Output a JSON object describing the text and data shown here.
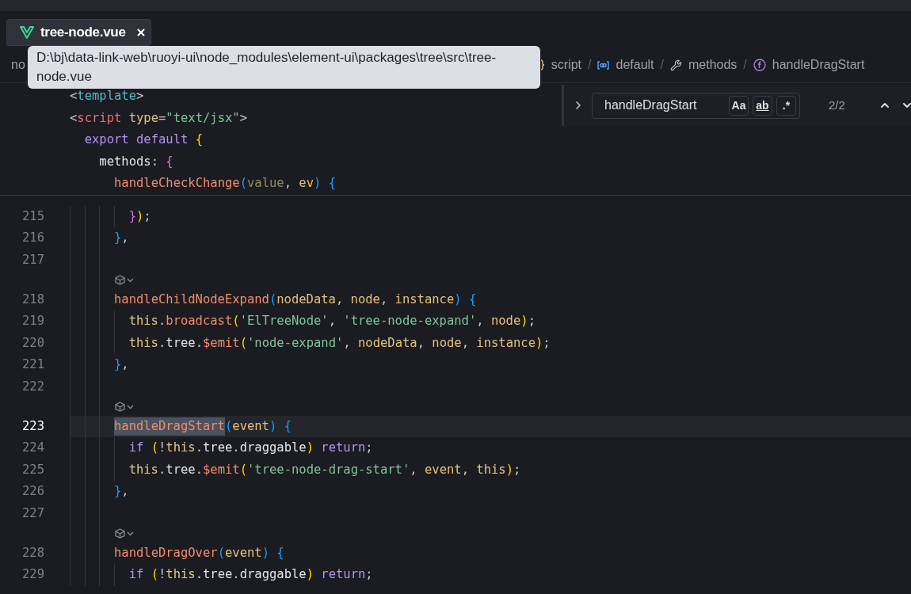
{
  "tab": {
    "label": "tree-node.vue",
    "selected": true
  },
  "tooltip": {
    "text": "D:\\bj\\data-link-web\\ruoyi-ui\\node_modules\\element-ui\\packages\\tree\\src\\tree-node.vue"
  },
  "breadcrumb": [
    {
      "kind": "text",
      "text": "no"
    },
    {
      "kind": "script",
      "text": "script",
      "separator": "/"
    },
    {
      "kind": "module",
      "text": "default",
      "separator": "/"
    },
    {
      "kind": "property",
      "text": "methods",
      "separator": "/"
    },
    {
      "kind": "function",
      "text": "handleDragStart"
    }
  ],
  "find_widget": {
    "value": "handleDragStart",
    "options": [
      {
        "kind": "case",
        "label": "Aa",
        "selected": false
      },
      {
        "kind": "word",
        "label": "ab",
        "selected": false
      },
      {
        "kind": "regex",
        "label": ".*",
        "selected": false
      }
    ],
    "count": "2/2"
  },
  "sticky_lines": [
    {
      "tokens": [
        {
          "text": "<",
          "kind": "punct"
        },
        {
          "text": "template",
          "kind": "template_tag"
        },
        {
          "text": ">",
          "kind": "punct"
        }
      ]
    },
    {
      "tokens": [
        {
          "text": "<",
          "kind": "punct"
        },
        {
          "text": "script",
          "kind": "tag"
        },
        {
          "text": " type",
          "kind": "attr"
        },
        {
          "text": "=",
          "kind": "punct"
        },
        {
          "text": "\"text/jsx\"",
          "kind": "string"
        },
        {
          "text": ">",
          "kind": "punct"
        }
      ]
    },
    {
      "tokens": [
        {
          "text": "  export default",
          "kind": "keyword"
        },
        {
          "text": " {",
          "kind": "bracket1"
        }
      ]
    },
    {
      "tokens": [
        {
          "text": "    methods",
          "kind": "prop"
        },
        {
          "text": ": ",
          "kind": "punct"
        },
        {
          "text": "{",
          "kind": "bracket2"
        }
      ]
    },
    {
      "tokens": [
        {
          "text": "      handleCheckChange",
          "kind": "func"
        },
        {
          "text": "(",
          "kind": "bracket3"
        },
        {
          "text": "value",
          "kind": "unused"
        },
        {
          "text": ", ",
          "kind": "punct"
        },
        {
          "text": "ev",
          "kind": "param"
        },
        {
          "text": ")",
          "kind": "bracket3"
        },
        {
          "text": " {",
          "kind": "bracket3"
        }
      ]
    }
  ],
  "lines": [
    {
      "kind": "code",
      "number": "215",
      "current": false,
      "tokens": [
        {
          "text": "        }",
          "kind": "bracket2"
        },
        {
          "text": ")",
          "kind": "bracket1"
        },
        {
          "text": ";",
          "kind": "punct"
        }
      ]
    },
    {
      "kind": "code",
      "number": "216",
      "current": false,
      "tokens": [
        {
          "text": "      }",
          "kind": "bracket3"
        },
        {
          "text": ",",
          "kind": "punct"
        }
      ]
    },
    {
      "kind": "code",
      "number": "217",
      "current": false
    },
    {
      "kind": "codelens"
    },
    {
      "kind": "code",
      "number": "218",
      "current": false,
      "tokens": [
        {
          "text": "      handleChildNodeExpand",
          "kind": "func"
        },
        {
          "text": "(",
          "kind": "bracket3"
        },
        {
          "text": "nodeData",
          "kind": "param"
        },
        {
          "text": ", ",
          "kind": "punct"
        },
        {
          "text": "node",
          "kind": "param"
        },
        {
          "text": ", ",
          "kind": "punct"
        },
        {
          "text": "instance",
          "kind": "param"
        },
        {
          "text": ")",
          "kind": "bracket3"
        },
        {
          "text": " {",
          "kind": "bracket3"
        }
      ]
    },
    {
      "kind": "code",
      "number": "219",
      "current": false,
      "tokens": [
        {
          "text": "        this",
          "kind": "this"
        },
        {
          "text": ".",
          "kind": "punct"
        },
        {
          "text": "broadcast",
          "kind": "func"
        },
        {
          "text": "(",
          "kind": "bracket1"
        },
        {
          "text": "'ElTreeNode'",
          "kind": "string"
        },
        {
          "text": ", ",
          "kind": "punct"
        },
        {
          "text": "'tree-node-expand'",
          "kind": "string"
        },
        {
          "text": ", ",
          "kind": "punct"
        },
        {
          "text": "node",
          "kind": "param"
        },
        {
          "text": ")",
          "kind": "bracket1"
        },
        {
          "text": ";",
          "kind": "punct"
        }
      ]
    },
    {
      "kind": "code",
      "number": "220",
      "current": false,
      "tokens": [
        {
          "text": "        this",
          "kind": "this"
        },
        {
          "text": ".",
          "kind": "punct"
        },
        {
          "text": "tree",
          "kind": "prop"
        },
        {
          "text": ".",
          "kind": "punct"
        },
        {
          "text": "$emit",
          "kind": "func"
        },
        {
          "text": "(",
          "kind": "bracket1"
        },
        {
          "text": "'node-expand'",
          "kind": "string"
        },
        {
          "text": ", ",
          "kind": "punct"
        },
        {
          "text": "nodeData",
          "kind": "param"
        },
        {
          "text": ", ",
          "kind": "punct"
        },
        {
          "text": "node",
          "kind": "param"
        },
        {
          "text": ", ",
          "kind": "punct"
        },
        {
          "text": "instance",
          "kind": "param"
        },
        {
          "text": ")",
          "kind": "bracket1"
        },
        {
          "text": ";",
          "kind": "punct"
        }
      ]
    },
    {
      "kind": "code",
      "number": "221",
      "current": false,
      "tokens": [
        {
          "text": "      }",
          "kind": "bracket3"
        },
        {
          "text": ",",
          "kind": "punct"
        }
      ]
    },
    {
      "kind": "code",
      "number": "222",
      "current": false
    },
    {
      "kind": "codelens"
    },
    {
      "kind": "code",
      "number": "223",
      "current": true,
      "tokens": [
        {
          "text": "      handleDragStart",
          "kind": "func_match"
        },
        {
          "text": "(",
          "kind": "bracket3"
        },
        {
          "text": "event",
          "kind": "param"
        },
        {
          "text": ")",
          "kind": "bracket3"
        },
        {
          "text": " {",
          "kind": "bracket3"
        }
      ]
    },
    {
      "kind": "code",
      "number": "224",
      "current": false,
      "tokens": [
        {
          "text": "        if",
          "kind": "keyword"
        },
        {
          "text": " (",
          "kind": "bracket1"
        },
        {
          "text": "!",
          "kind": "punct"
        },
        {
          "text": "this",
          "kind": "this"
        },
        {
          "text": ".",
          "kind": "punct"
        },
        {
          "text": "tree",
          "kind": "prop"
        },
        {
          "text": ".",
          "kind": "punct"
        },
        {
          "text": "draggable",
          "kind": "prop"
        },
        {
          "text": ")",
          "kind": "bracket1"
        },
        {
          "text": " return",
          "kind": "keyword"
        },
        {
          "text": ";",
          "kind": "punct"
        }
      ]
    },
    {
      "kind": "code",
      "number": "225",
      "current": false,
      "tokens": [
        {
          "text": "        this",
          "kind": "this"
        },
        {
          "text": ".",
          "kind": "punct"
        },
        {
          "text": "tree",
          "kind": "prop"
        },
        {
          "text": ".",
          "kind": "punct"
        },
        {
          "text": "$emit",
          "kind": "func"
        },
        {
          "text": "(",
          "kind": "bracket1"
        },
        {
          "text": "'tree-node-drag-start'",
          "kind": "string"
        },
        {
          "text": ", ",
          "kind": "punct"
        },
        {
          "text": "event",
          "kind": "param"
        },
        {
          "text": ", ",
          "kind": "punct"
        },
        {
          "text": "this",
          "kind": "this"
        },
        {
          "text": ")",
          "kind": "bracket1"
        },
        {
          "text": ";",
          "kind": "punct"
        }
      ]
    },
    {
      "kind": "code",
      "number": "226",
      "current": false,
      "tokens": [
        {
          "text": "      }",
          "kind": "bracket3"
        },
        {
          "text": ",",
          "kind": "punct"
        }
      ]
    },
    {
      "kind": "code",
      "number": "227",
      "current": false
    },
    {
      "kind": "codelens"
    },
    {
      "kind": "code",
      "number": "228",
      "current": false,
      "tokens": [
        {
          "text": "      handleDragOver",
          "kind": "func"
        },
        {
          "text": "(",
          "kind": "bracket3"
        },
        {
          "text": "event",
          "kind": "param"
        },
        {
          "text": ")",
          "kind": "bracket3"
        },
        {
          "text": " {",
          "kind": "bracket3"
        }
      ]
    },
    {
      "kind": "code",
      "number": "229",
      "current": false,
      "tokens": [
        {
          "text": "        if",
          "kind": "keyword"
        },
        {
          "text": " (",
          "kind": "bracket1"
        },
        {
          "text": "!",
          "kind": "punct"
        },
        {
          "text": "this",
          "kind": "this"
        },
        {
          "text": ".",
          "kind": "punct"
        },
        {
          "text": "tree",
          "kind": "prop"
        },
        {
          "text": ".",
          "kind": "punct"
        },
        {
          "text": "draggable",
          "kind": "prop"
        },
        {
          "text": ")",
          "kind": "bracket1"
        },
        {
          "text": " return",
          "kind": "keyword"
        },
        {
          "text": ";",
          "kind": "punct"
        }
      ]
    }
  ]
}
